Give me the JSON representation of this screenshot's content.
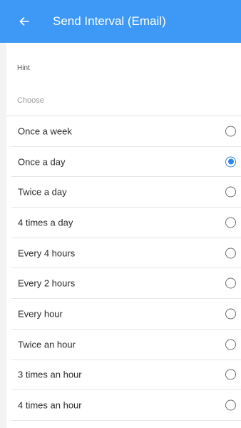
{
  "header": {
    "back_icon": "arrow-left-icon",
    "title": "Send Interval (Email)",
    "background_color": "#3d99f5"
  },
  "hint": {
    "label": "Hint",
    "choose": "Choose"
  },
  "options": {
    "selected_index": 1,
    "accent_color": "#2f86e8",
    "items": [
      {
        "label": "Once a week",
        "selected": false
      },
      {
        "label": "Once a day",
        "selected": true
      },
      {
        "label": "Twice a day",
        "selected": false
      },
      {
        "label": "4 times a day",
        "selected": false
      },
      {
        "label": "Every 4 hours",
        "selected": false
      },
      {
        "label": "Every 2 hours",
        "selected": false
      },
      {
        "label": "Every hour",
        "selected": false
      },
      {
        "label": "Twice an hour",
        "selected": false
      },
      {
        "label": "3 times an hour",
        "selected": false
      },
      {
        "label": "4 times an hour",
        "selected": false
      }
    ]
  }
}
